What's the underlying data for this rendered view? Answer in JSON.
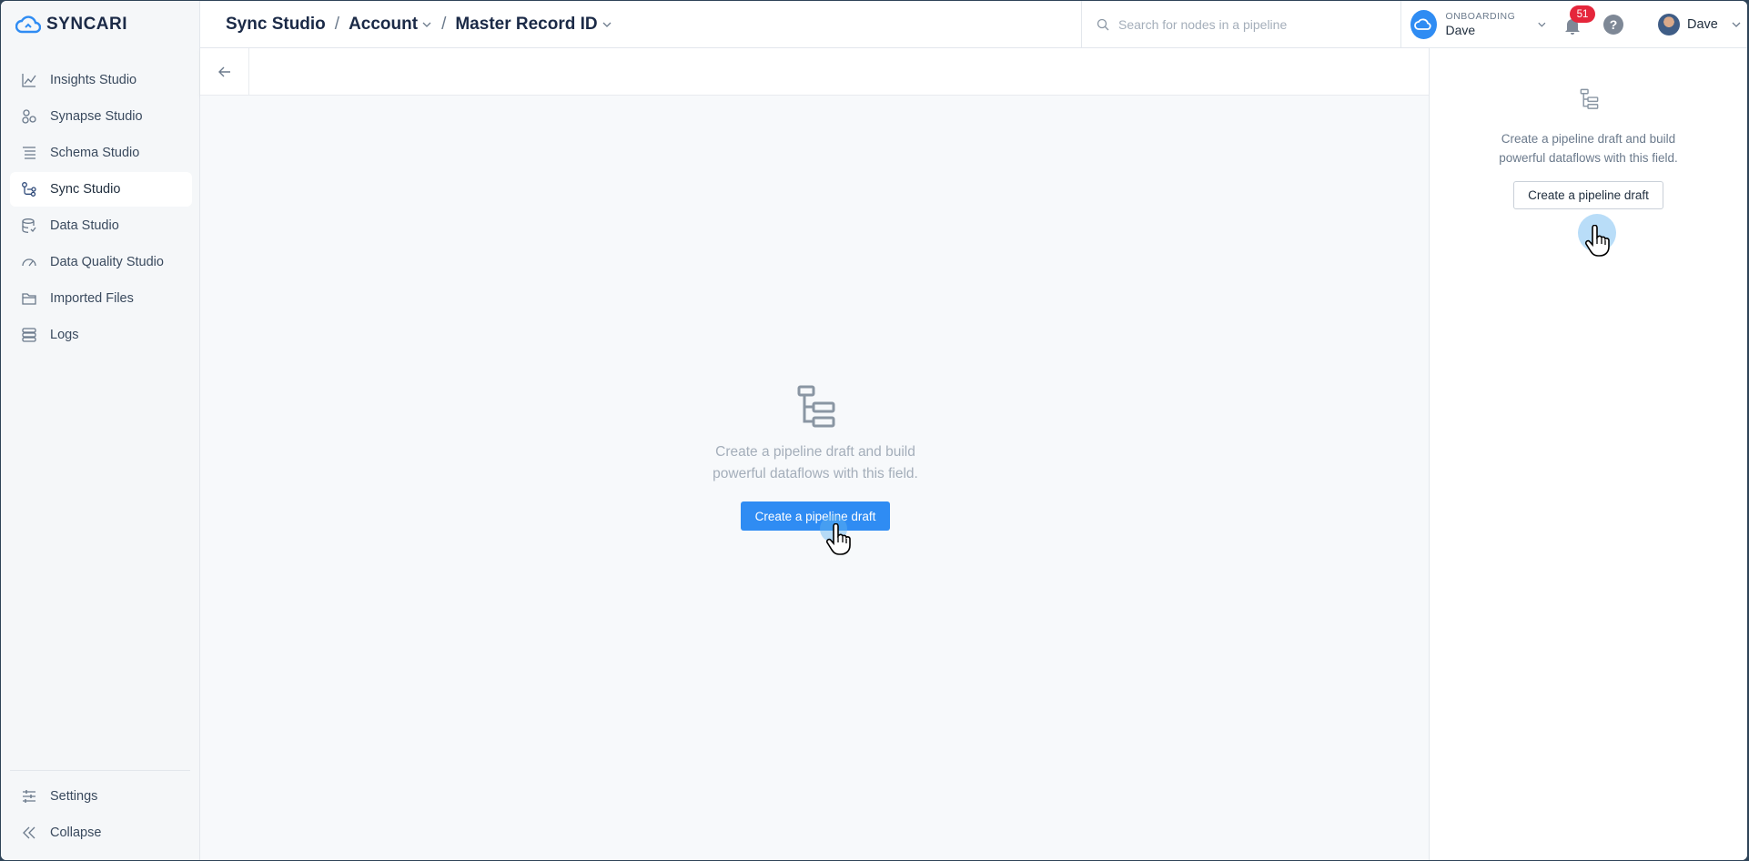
{
  "app": {
    "brand": "SYNCARI",
    "accent_color": "#2f8cf3"
  },
  "sidebar": {
    "items": [
      {
        "label": "Insights Studio",
        "icon": "chart-line-icon"
      },
      {
        "label": "Synapse Studio",
        "icon": "nodes-icon"
      },
      {
        "label": "Schema Studio",
        "icon": "schema-list-icon"
      },
      {
        "label": "Sync Studio",
        "icon": "sync-flow-icon",
        "active": true
      },
      {
        "label": "Data Studio",
        "icon": "database-icon"
      },
      {
        "label": "Data Quality Studio",
        "icon": "gauge-icon"
      },
      {
        "label": "Imported Files",
        "icon": "folder-icon"
      },
      {
        "label": "Logs",
        "icon": "logs-icon"
      }
    ],
    "settings_label": "Settings",
    "collapse_label": "Collapse"
  },
  "header": {
    "breadcrumb": {
      "root": "Sync Studio",
      "entity": "Account",
      "field": "Master Record ID",
      "separator": "/"
    },
    "search_placeholder": "Search for nodes in a pipeline",
    "org_label": "ONBOARDING",
    "org_name": "Dave",
    "notification_count": "51",
    "help": "?",
    "user_name": "Dave"
  },
  "main": {
    "empty_text_line1": "Create a pipeline draft and build",
    "empty_text_line2": "powerful dataflows with this field.",
    "create_button": "Create a pipeline draft"
  },
  "right_panel": {
    "empty_text_line1": "Create a pipeline draft and build",
    "empty_text_line2": "powerful dataflows with this field.",
    "create_button": "Create a pipeline draft"
  }
}
